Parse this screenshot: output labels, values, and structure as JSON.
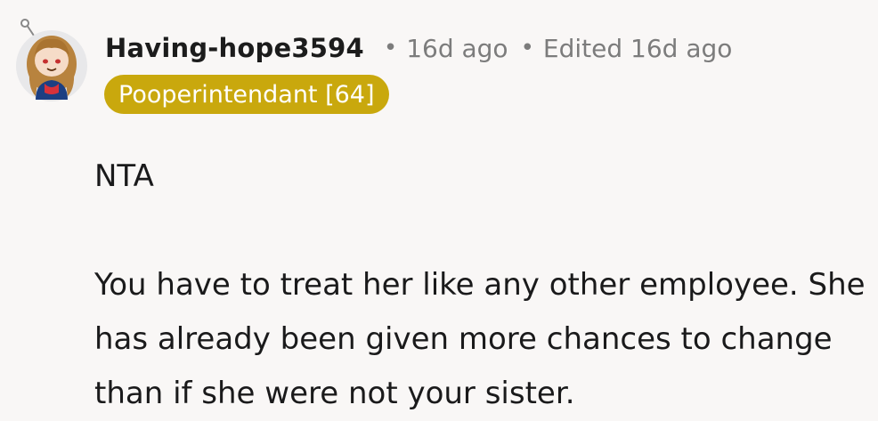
{
  "comment": {
    "author": "Having-hope3594",
    "separator": "•",
    "timestamp": "16d ago",
    "edited": "Edited 16d ago",
    "flair": "Pooperintendant [64]",
    "flair_color": "#c9a80d",
    "avatar_icon": "user-avatar-icon",
    "paragraphs": [
      "NTA",
      "You have to treat her like any other employee. She has already been given more chances to change than if she were not your sister."
    ]
  },
  "colors": {
    "background": "#f9f7f6",
    "meta_text": "#7c7c7c",
    "body_text": "#1a1a1b"
  }
}
